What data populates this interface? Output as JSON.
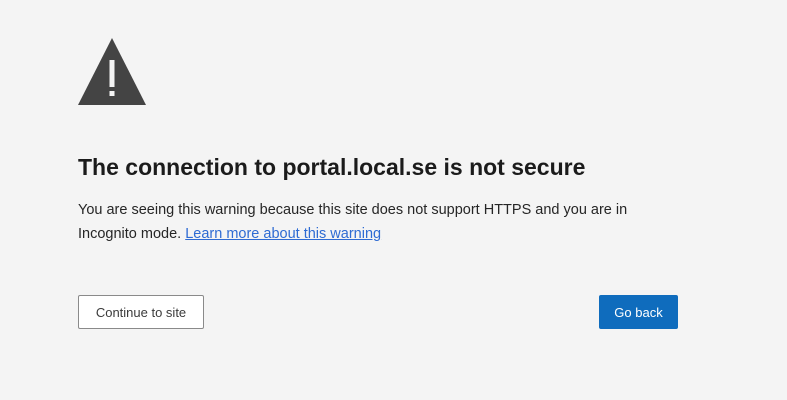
{
  "warning": {
    "icon": "warning-triangle-icon",
    "icon_color": "#444444",
    "title": "The connection to portal.local.se is not secure",
    "message": "You are seeing this warning because this site does not support HTTPS and you are in Incognito mode.",
    "learn_more_link": "Learn more about this warning"
  },
  "actions": {
    "continue_label": "Continue to site",
    "back_label": "Go back"
  },
  "colors": {
    "background": "#f4f4f4",
    "primary_button": "#0f6cbd",
    "link": "#2e6bd3"
  }
}
